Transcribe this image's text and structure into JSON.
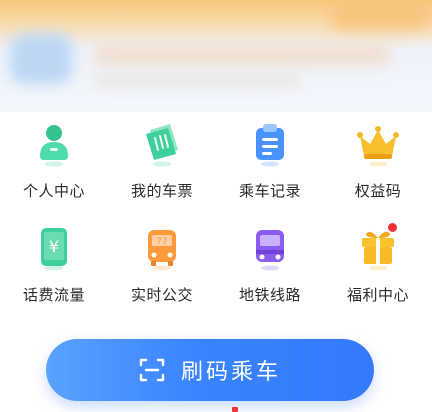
{
  "menu": {
    "items": [
      {
        "label": "个人中心",
        "icon": "profile-icon"
      },
      {
        "label": "我的车票",
        "icon": "ticket-icon"
      },
      {
        "label": "乘车记录",
        "icon": "clipboard-icon"
      },
      {
        "label": "权益码",
        "icon": "crown-icon"
      },
      {
        "label": "话费流量",
        "icon": "phone-yuan-icon"
      },
      {
        "label": "实时公交",
        "icon": "bus-icon"
      },
      {
        "label": "地铁线路",
        "icon": "metro-icon"
      },
      {
        "label": "福利中心",
        "icon": "gift-icon",
        "badge": true
      }
    ]
  },
  "scan_button": {
    "label": "刷码乘车",
    "icon": "scan-icon"
  },
  "colors": {
    "accent_blue": "#3a84ff",
    "icon_green": "#3ecf9a",
    "icon_orange": "#ff9f45",
    "icon_purple": "#8a5cf0",
    "icon_gold": "#f7b928",
    "badge_red": "#f1323c"
  }
}
